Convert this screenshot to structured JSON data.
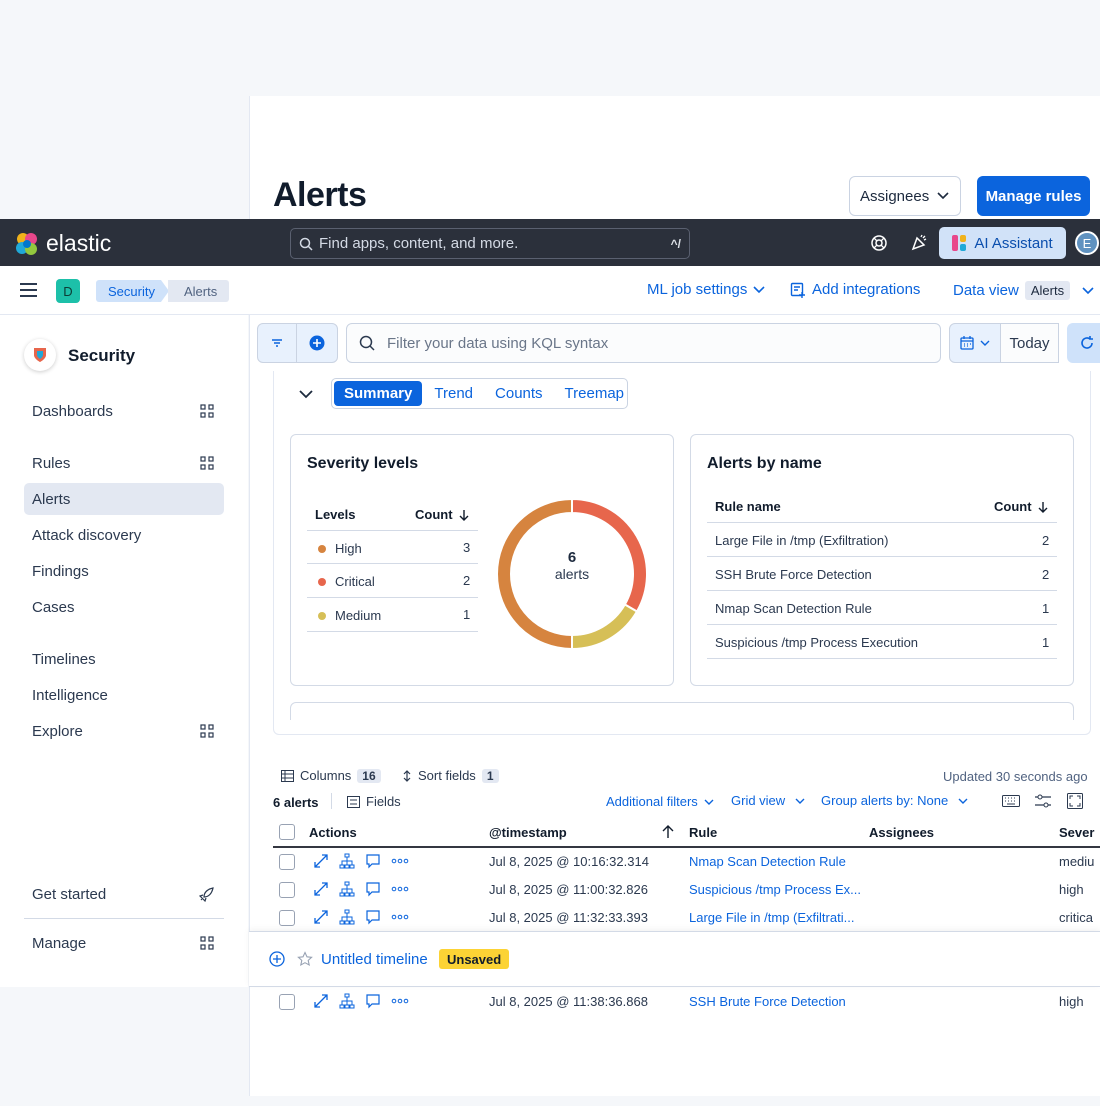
{
  "page": {
    "title": "Alerts",
    "assignees_label": "Assignees",
    "manage_rules_label": "Manage rules"
  },
  "header": {
    "logo_text": "elastic",
    "search_placeholder": "Find apps, content, and more.",
    "search_shortcut": "^/",
    "ai_assistant_label": "AI Assistant",
    "user_initial": "E"
  },
  "subheader": {
    "space_initial": "D",
    "breadcrumbs": [
      "Security",
      "Alerts"
    ],
    "ml_job_settings": "ML job settings",
    "add_integrations": "Add integrations",
    "data_view_label": "Data view",
    "data_view_value": "Alerts"
  },
  "nav": {
    "title": "Security",
    "items": [
      "Dashboards",
      "Rules",
      "Alerts",
      "Attack discovery",
      "Findings",
      "Cases",
      "Timelines",
      "Intelligence",
      "Explore",
      "Get started",
      "Manage"
    ],
    "active": "Alerts"
  },
  "filter": {
    "kql_placeholder": "Filter your data using KQL syntax",
    "date_label": "Today"
  },
  "summary": {
    "tabs": [
      "Summary",
      "Trend",
      "Counts",
      "Treemap"
    ],
    "selected_tab": "Summary",
    "severity": {
      "title": "Severity levels",
      "col_levels": "Levels",
      "col_count": "Count",
      "rows": [
        {
          "level": "High",
          "count": "3",
          "color": "#d6843f"
        },
        {
          "level": "Critical",
          "count": "2",
          "color": "#e7664c"
        },
        {
          "level": "Medium",
          "count": "1",
          "color": "#d6bf57"
        }
      ],
      "donut_total": "6",
      "donut_label": "alerts"
    },
    "by_name": {
      "title": "Alerts by name",
      "col_rule": "Rule name",
      "col_count": "Count",
      "rows": [
        {
          "name": "Large File in /tmp (Exfiltration)",
          "count": "2"
        },
        {
          "name": "SSH Brute Force Detection",
          "count": "2"
        },
        {
          "name": "Nmap Scan Detection Rule",
          "count": "1"
        },
        {
          "name": "Suspicious /tmp Process Execution",
          "count": "1"
        }
      ]
    }
  },
  "table": {
    "columns_label": "Columns",
    "columns_count": "16",
    "sort_label": "Sort fields",
    "sort_count": "1",
    "updated": "Updated 30 seconds ago",
    "alert_count": "6 alerts",
    "fields_label": "Fields",
    "additional_filters": "Additional filters",
    "grid_view": "Grid view",
    "group_by": "Group alerts by: None",
    "headers": {
      "actions": "Actions",
      "timestamp": "@timestamp",
      "rule": "Rule",
      "assignees": "Assignees",
      "severity": "Sever"
    },
    "rows": [
      {
        "timestamp": "Jul 8, 2025 @ 10:16:32.314",
        "rule": "Nmap Scan Detection Rule",
        "severity": "mediu"
      },
      {
        "timestamp": "Jul 8, 2025 @ 11:00:32.826",
        "rule": "Suspicious /tmp Process Ex...",
        "severity": "high"
      },
      {
        "timestamp": "Jul 8, 2025 @ 11:32:33.393",
        "rule": "Large File in /tmp (Exfiltrati...",
        "severity": "critica"
      },
      {
        "timestamp": "Jul 8, 2025 @ 11:38:36.868",
        "rule": "SSH Brute Force Detection",
        "severity": "high"
      }
    ]
  },
  "timeline": {
    "title": "Untitled timeline",
    "status": "Unsaved"
  }
}
